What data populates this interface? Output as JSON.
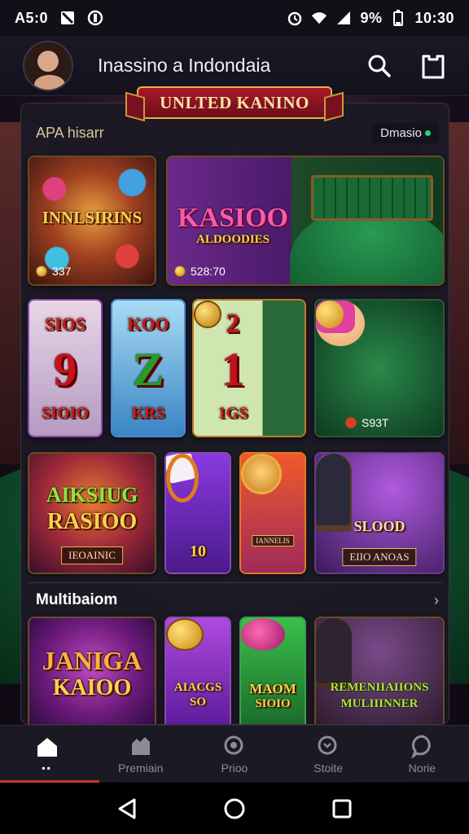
{
  "status_bar": {
    "time": "A5:0",
    "battery_text": "9%",
    "clock": "10:30"
  },
  "header": {
    "title": "Inassino a Indondaia"
  },
  "banner": {
    "text": "UNLTED KANINO"
  },
  "section1": {
    "title": "APA hisarr",
    "button_label": "Dmasio"
  },
  "section2": {
    "title": "Multibaiom"
  },
  "tiles": {
    "t1": {
      "title": "INNLSIRINS",
      "meta": "337"
    },
    "t2": {
      "title": "KASIOO",
      "subtitle": "ALDOODIES",
      "meta": "528:70"
    },
    "t3": {
      "top": "SIOS",
      "num": "9",
      "bottom": "SIOIO"
    },
    "t4": {
      "top": "KOO",
      "num": "Z",
      "bottom": "KRS"
    },
    "t5": {
      "num": "1",
      "bottom": "1GS"
    },
    "t6": {
      "meta": "S93T"
    },
    "t7": {
      "title": "AIKSIUG",
      "subtitle": "RASIOO",
      "plate": "IEOAINIC"
    },
    "t8": {
      "num": "10"
    },
    "t9": {
      "plate": "IANNELIS"
    },
    "t10": {
      "title": "SLOOD",
      "plate": "EIIO ANOAS"
    },
    "t11": {
      "title": "JANIGA",
      "subtitle": "KAIOO"
    },
    "t12": {
      "title": "AIACGS",
      "subtitle": "SO"
    },
    "t13": {
      "title": "MAOM",
      "subtitle": "SIOIO"
    },
    "t14": {
      "title": "REMENIIAIIONS",
      "subtitle": "MULIIINNER"
    }
  },
  "bottom_nav": {
    "home_label": "",
    "premium_label": "Premiain",
    "prize_label": "Prioo",
    "store_label": "Stoite",
    "more_label": "Norie"
  },
  "colors": {
    "accent": "#c23a2e",
    "gold": "#e2b14a",
    "panel": "#1c1924"
  }
}
